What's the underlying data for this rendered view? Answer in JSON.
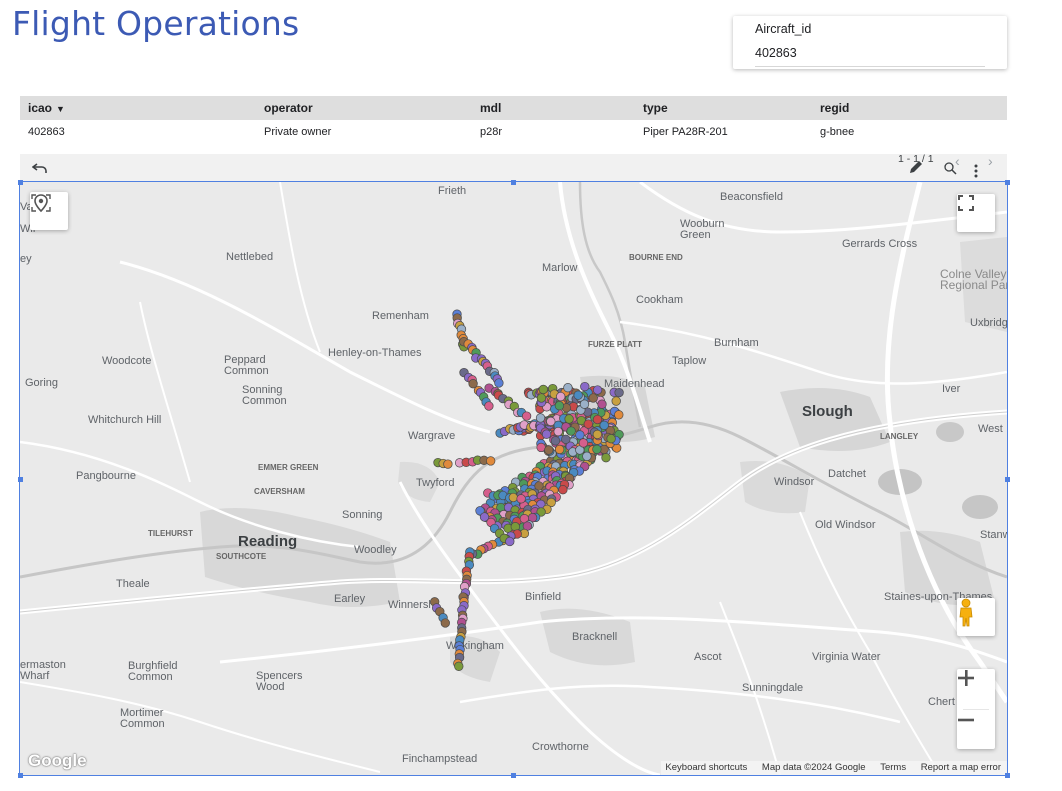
{
  "page": {
    "title": "Flight Operations"
  },
  "filter": {
    "label": "Aircraft_id",
    "value": "402863"
  },
  "table": {
    "columns": [
      "icao",
      "operator",
      "mdl",
      "type",
      "regid"
    ],
    "sort_indicator": "▼",
    "rows": [
      [
        "402863",
        "Private owner",
        "p28r",
        "Piper PA28R-201",
        "g-bnee"
      ]
    ]
  },
  "toolbar": {
    "undo_icon": "undo-icon",
    "pagination": "1 - 1 / 1",
    "icons": [
      "edit-icon",
      "zoom-icon",
      "chevron-left-icon",
      "chevron-right-icon",
      "more-vert-icon"
    ]
  },
  "map": {
    "towns": [
      {
        "name": "Frieth"
      },
      {
        "name": "Beaconsfield"
      },
      {
        "name": "Wooburn Green"
      },
      {
        "name": "Nettlebed"
      },
      {
        "name": "Marlow"
      },
      {
        "name": "BOURNE END"
      },
      {
        "name": "Gerrards Cross"
      },
      {
        "name": "Colne Valley Regional Park"
      },
      {
        "name": "Cookham"
      },
      {
        "name": "Remenham"
      },
      {
        "name": "Uxbridge"
      },
      {
        "name": "Woodcote"
      },
      {
        "name": "Peppard Common"
      },
      {
        "name": "Henley-on-Thames"
      },
      {
        "name": "FURZE PLATT"
      },
      {
        "name": "Burnham"
      },
      {
        "name": "Taplow"
      },
      {
        "name": "Goring"
      },
      {
        "name": "Sonning Common"
      },
      {
        "name": "Maidenhead"
      },
      {
        "name": "Iver"
      },
      {
        "name": "Slough"
      },
      {
        "name": "Whitchurch Hill"
      },
      {
        "name": "Wargrave"
      },
      {
        "name": "LANGLEY"
      },
      {
        "name": "West"
      },
      {
        "name": "EMMER GREEN"
      },
      {
        "name": "Datchet"
      },
      {
        "name": "Pangbourne"
      },
      {
        "name": "Twyford"
      },
      {
        "name": "Windsor"
      },
      {
        "name": "CAVERSHAM"
      },
      {
        "name": "Sonning"
      },
      {
        "name": "Old Windsor"
      },
      {
        "name": "TILEHURST"
      },
      {
        "name": "Reading"
      },
      {
        "name": "SOUTHCOTE"
      },
      {
        "name": "Woodley"
      },
      {
        "name": "Stanw"
      },
      {
        "name": "Theale"
      },
      {
        "name": "Binfield"
      },
      {
        "name": "Earley"
      },
      {
        "name": "Winnersh"
      },
      {
        "name": "Staines-upon-Thames"
      },
      {
        "name": "Bracknell"
      },
      {
        "name": "Wokingham"
      },
      {
        "name": "ermaston Wharf"
      },
      {
        "name": "Burghfield Common"
      },
      {
        "name": "Ascot"
      },
      {
        "name": "Virginia Water"
      },
      {
        "name": "Spencers Wood"
      },
      {
        "name": "Sunningdale"
      },
      {
        "name": "Chert"
      },
      {
        "name": "Mortimer Common"
      },
      {
        "name": "Crowthorne"
      },
      {
        "name": "Finchampstead"
      },
      {
        "name": "Va"
      },
      {
        "name": "Wir"
      },
      {
        "name": "ey"
      }
    ],
    "attribution": [
      "Keyboard shortcuts",
      "Map data ©2024 Google",
      "Terms",
      "Report a map error"
    ],
    "logo": "Google",
    "controls": [
      "my-location-icon",
      "fullscreen-icon",
      "pegman-icon",
      "zoom-in-icon",
      "zoom-out-icon"
    ],
    "point_colors": [
      "#d65f8c",
      "#5b7fd6",
      "#e08a3c",
      "#8a6ac8",
      "#4f9a5a",
      "#c94a4a",
      "#9bb0c8",
      "#8c6a4a",
      "#e0a0c8",
      "#6a6a8a",
      "#c8a040",
      "#4a8ac0",
      "#b05090",
      "#7a9a3a"
    ]
  }
}
